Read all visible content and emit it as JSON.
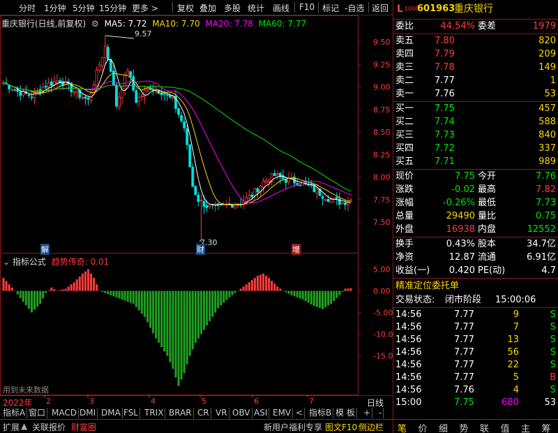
{
  "toolbar": {
    "items": [
      "分时",
      "1分钟",
      "5分钟",
      "15分钟",
      "更多 >",
      "复权",
      "叠加",
      "多股",
      "统计",
      "画线",
      "F10",
      "标记",
      "-自选",
      "返回"
    ]
  },
  "chart": {
    "title": "重庆银行(日线,前复权)",
    "ma5": "MA5: 7.72",
    "ma10": "MA10: 7.70",
    "ma20": "MA20: 7.78",
    "ma60": "MA60: 7.77",
    "high_label": "9.57",
    "low_label": "7.30",
    "price_axis": [
      "9.50",
      "9.25",
      "9.00",
      "8.75",
      "8.50",
      "8.25",
      "8.00",
      "7.75",
      "7.50"
    ],
    "markers": [
      "解",
      "财",
      "增"
    ]
  },
  "indicator": {
    "title": "指标公式",
    "name": "趋势传奇: 0.01",
    "axis": [
      "5.00",
      "0.00",
      "-5.00",
      "-10.00",
      "-15.00"
    ],
    "future_note": "用到未来数据"
  },
  "time_axis": {
    "labels": [
      "2022年",
      "2",
      "3",
      "4",
      "5",
      "6",
      "7"
    ],
    "period": "日线"
  },
  "bottom_tabs": [
    "指标A",
    "窗口",
    "MACD",
    "DMI",
    "DMA",
    "FSL",
    "TRIX",
    "BRAR",
    "CR",
    "VR",
    "OBV",
    "ASI",
    "EMV",
    "<",
    "指标B",
    "模 板",
    "+",
    "-"
  ],
  "status_bar": {
    "items": [
      "扩展",
      "关联报价",
      "财富圈"
    ],
    "right": [
      "新用户福利专享",
      "图文F10",
      "侧边栏"
    ]
  },
  "quote": {
    "code": "601963",
    "name": "重庆银行",
    "level": "L",
    "level_sub": "1000",
    "weibi_label": "委比",
    "weibi": "44.54%",
    "weicha_label": "委差",
    "weicha": "1979",
    "asks": [
      {
        "label": "卖五",
        "price": "7.80",
        "vol": "820"
      },
      {
        "label": "卖四",
        "price": "7.79",
        "vol": "209"
      },
      {
        "label": "卖三",
        "price": "7.78",
        "vol": "149"
      },
      {
        "label": "卖二",
        "price": "7.77",
        "vol": "1"
      },
      {
        "label": "卖一",
        "price": "7.76",
        "vol": "53"
      }
    ],
    "bids": [
      {
        "label": "买一",
        "price": "7.75",
        "vol": "457"
      },
      {
        "label": "买二",
        "price": "7.74",
        "vol": "588"
      },
      {
        "label": "买三",
        "price": "7.73",
        "vol": "840"
      },
      {
        "label": "买四",
        "price": "7.72",
        "vol": "337"
      },
      {
        "label": "买五",
        "price": "7.71",
        "vol": "989"
      }
    ],
    "stats": [
      {
        "l1": "现价",
        "v1": "7.75",
        "l2": "今开",
        "v2": "7.76"
      },
      {
        "l1": "涨跌",
        "v1": "-0.02",
        "l2": "最高",
        "v2": "7.82"
      },
      {
        "l1": "涨幅",
        "v1": "-0.26%",
        "l2": "最低",
        "v2": "7.73"
      },
      {
        "l1": "总量",
        "v1": "29490",
        "l2": "量比",
        "v2": "0.75"
      },
      {
        "l1": "外盘",
        "v1": "16938",
        "l2": "内盘",
        "v2": "12552"
      }
    ],
    "stats2": [
      {
        "l1": "换手",
        "v1": "0.43%",
        "l2": "股本",
        "v2": "34.7亿"
      },
      {
        "l1": "净资",
        "v1": "12.87",
        "l2": "流通",
        "v2": "6.91亿"
      },
      {
        "l1": "收益(一)",
        "v1": "0.420",
        "l2": "PE(动)",
        "v2": "4.7"
      }
    ],
    "precise_title": "精准定位委托单",
    "trade_state_label": "交易状态:",
    "trade_state": "闭市阶段",
    "trade_time": "15:00:06",
    "ticks": [
      {
        "t": "14:56",
        "p": "7.77",
        "v": "9",
        "d": "S"
      },
      {
        "t": "14:56",
        "p": "7.77",
        "v": "7",
        "d": "S"
      },
      {
        "t": "14:56",
        "p": "7.77",
        "v": "13",
        "d": "S"
      },
      {
        "t": "14:56",
        "p": "7.77",
        "v": "56",
        "d": "S"
      },
      {
        "t": "14:56",
        "p": "7.77",
        "v": "22",
        "d": "S"
      },
      {
        "t": "14:56",
        "p": "7.77",
        "v": "5",
        "d": "B"
      },
      {
        "t": "14:56",
        "p": "7.76",
        "v": "4",
        "d": "S"
      },
      {
        "t": "15:00",
        "p": "7.75",
        "v": "680",
        "d": "53"
      }
    ],
    "tabs": [
      "笔",
      "价",
      "细",
      "势",
      "联",
      "值",
      "主",
      "筹"
    ]
  }
}
